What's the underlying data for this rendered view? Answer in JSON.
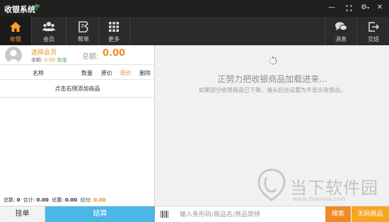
{
  "titlebar": {
    "title": "收银系统",
    "minimize": "—",
    "maximize": "⚙",
    "close": "✕"
  },
  "nav": {
    "cashier": "收银",
    "member": "会员",
    "orders": "帮单",
    "more": "更多",
    "messages": "消息",
    "handover": "交班"
  },
  "member": {
    "select_label": "选择会员",
    "balance_label": "余额:",
    "balance_value": "0.00",
    "recharge": "充值",
    "total_label": "总额:",
    "total_value": "0.00"
  },
  "table": {
    "headers": [
      "名称",
      "数量",
      "原价",
      "现价",
      "删除"
    ],
    "hint": "点击右侧添加商品"
  },
  "summary": {
    "count_label": "总数:",
    "count_value": "0",
    "sum_label": "合计:",
    "sum_value": "0.00",
    "discount_label": "优惠:",
    "discount_value": "0.00",
    "due_label": "应付:",
    "due_value": "0.00"
  },
  "loading": {
    "title": "正努力把收银商品加载进来...",
    "subtitle": "如果部分收银商品已下架，请从后台设置为不显示收银台。"
  },
  "watermark": {
    "text": "当下软件园",
    "url": "www.downxia.com"
  },
  "bottom": {
    "hold": "挂单",
    "checkout": "结算",
    "search_placeholder": "输入条形码/商品名/商品简拼",
    "search": "搜索",
    "no_code": "无码商品"
  },
  "colors": {
    "accent": "#f08a24",
    "checkout": "#4cb6e6",
    "titlebar": "#1f1f1f",
    "navbar": "#2b2b2b"
  }
}
